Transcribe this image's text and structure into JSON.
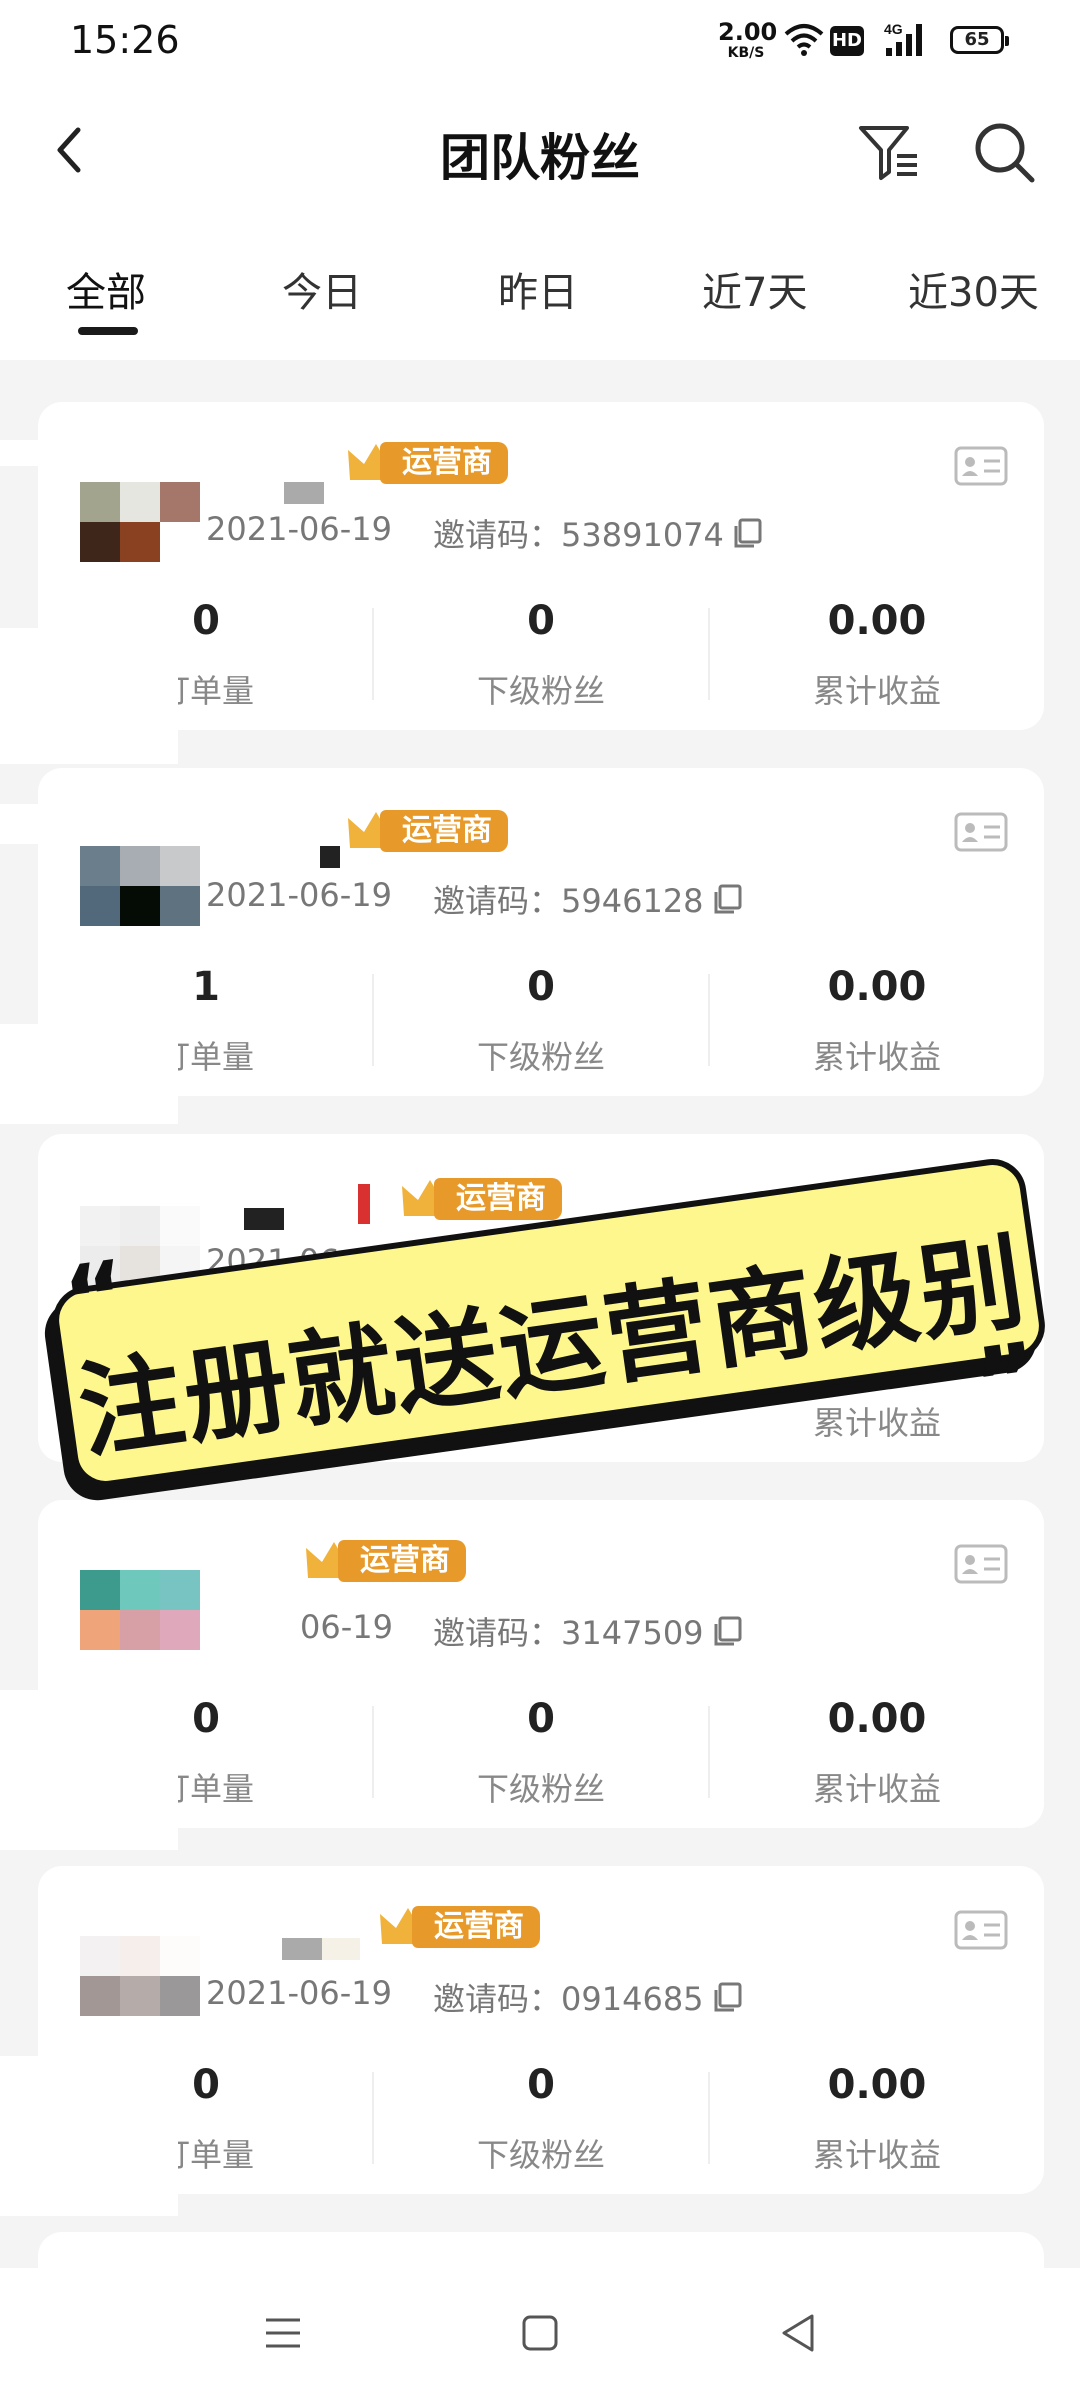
{
  "status_bar": {
    "time": "15:26",
    "net_speed_value": "2.00",
    "net_speed_unit": "KB/S",
    "hd_label": "HD",
    "network_type": "4G",
    "battery_level": "65"
  },
  "header": {
    "title": "团队粉丝",
    "icons": [
      "back-icon",
      "filter-icon",
      "search-icon"
    ]
  },
  "tabs": [
    {
      "label": "全部",
      "active": true
    },
    {
      "label": "今日",
      "active": false
    },
    {
      "label": "昨日",
      "active": false
    },
    {
      "label": "近7天",
      "active": false
    },
    {
      "label": "近30天",
      "active": false
    }
  ],
  "invite_prefix": "邀请码：",
  "members": [
    {
      "badge": "运营商",
      "date": "2021-06-19",
      "invite_code": "53891074",
      "stats": [
        {
          "value": "0",
          "label": "订单量"
        },
        {
          "value": "0",
          "label": "下级粉丝"
        },
        {
          "value": "0.00",
          "label": "累计收益"
        }
      ]
    },
    {
      "badge": "运营商",
      "date": "2021-06-19",
      "invite_code": "5946128",
      "stats": [
        {
          "value": "1",
          "label": "订单量"
        },
        {
          "value": "0",
          "label": "下级粉丝"
        },
        {
          "value": "0.00",
          "label": "累计收益"
        }
      ]
    },
    {
      "badge": "运营商",
      "date": "2021-06-19",
      "invite_code": "",
      "stats": [
        {
          "value": "",
          "label": ""
        },
        {
          "value": "",
          "label": ""
        },
        {
          "value": "",
          "label": "累计收益"
        }
      ]
    },
    {
      "badge": "运营商",
      "date": "06-19",
      "invite_code": "3147509",
      "stats": [
        {
          "value": "0",
          "label": "订单量"
        },
        {
          "value": "0",
          "label": "下级粉丝"
        },
        {
          "value": "0.00",
          "label": "累计收益"
        }
      ]
    },
    {
      "badge": "运营商",
      "date": "2021-06-19",
      "invite_code": "0914685",
      "stats": [
        {
          "value": "0",
          "label": "订单量"
        },
        {
          "value": "0",
          "label": "下级粉丝"
        },
        {
          "value": "0.00",
          "label": "累计收益"
        }
      ]
    }
  ],
  "promo_banner": {
    "text": "注册就送运营商级别"
  },
  "colors": {
    "badge_orange": "#e79a2a",
    "crown_gold": "#f0b23b",
    "banner_yellow": "#fdf78d"
  }
}
